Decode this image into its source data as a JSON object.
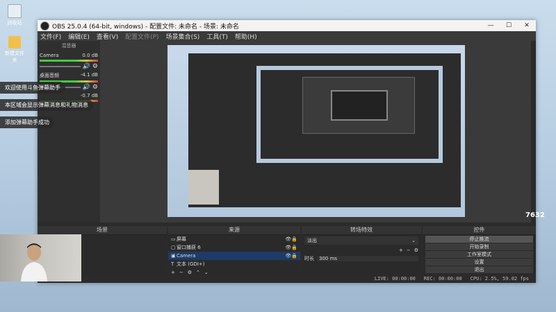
{
  "desktop": {
    "icons": [
      {
        "label": "回收站",
        "icon": "recycle-bin-icon"
      },
      {
        "label": "新建文件夹",
        "icon": "folder-icon"
      }
    ]
  },
  "window": {
    "title": "OBS 25.0.4 (64-bit, windows) - 配置文件: 未命名 - 场景: 未命名",
    "minimize": "—",
    "maximize": "☐",
    "close": "✕"
  },
  "menu": [
    "文件(F)",
    "编辑(E)",
    "查看(V)",
    "配置文件(P)",
    "场景集合(S)",
    "工具(T)",
    "帮助(H)"
  ],
  "mixer": {
    "header": "混音器",
    "tracks": [
      {
        "name": "Camera",
        "db": "0.0 dB"
      },
      {
        "name": "桌面音频",
        "db": "-4.1 dB"
      },
      {
        "name": "",
        "db": "-0.7 dB"
      }
    ]
  },
  "notifications": [
    "欢迎使用斗鱼弹幕助手",
    "本区域会显示弹幕消息和礼物消息",
    "添加弹幕助手成功"
  ],
  "docks": {
    "scenes": {
      "header": "场景"
    },
    "sources": {
      "header": "来源",
      "items": [
        {
          "name": "屏幕",
          "icon": "monitor-icon",
          "selected": false
        },
        {
          "name": "窗口捕获 6",
          "icon": "window-icon",
          "selected": false
        },
        {
          "name": "Camera",
          "icon": "camera-icon",
          "selected": true
        },
        {
          "name": "文本 (GDI+)",
          "icon": "text-icon",
          "selected": false
        }
      ]
    },
    "transitions": {
      "header": "转场特效",
      "type": "淡出",
      "duration_label": "时长",
      "duration": "300 ms"
    },
    "controls": {
      "header": "控件",
      "buttons": [
        "停止推流",
        "开始录制",
        "工作室模式",
        "设置",
        "退出"
      ]
    }
  },
  "status": {
    "live": "LIVE: 00:00:00",
    "rec": "REC: 00:00:00",
    "cpu": "CPU: 2.5%, 59.02 fps"
  },
  "watermark": "7632"
}
